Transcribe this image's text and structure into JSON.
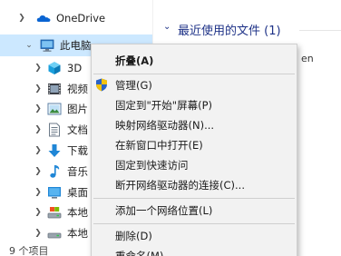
{
  "nav": {
    "onedrive": "OneDrive",
    "this_pc": "此电脑",
    "items": [
      {
        "label": "3D",
        "icon": "3d-objects-icon"
      },
      {
        "label": "视频",
        "icon": "videos-icon"
      },
      {
        "label": "图片",
        "icon": "pictures-icon"
      },
      {
        "label": "文档",
        "icon": "documents-icon"
      },
      {
        "label": "下载",
        "icon": "downloads-icon"
      },
      {
        "label": "音乐",
        "icon": "music-icon"
      },
      {
        "label": "桌面",
        "icon": "desktop-icon"
      },
      {
        "label": "本地",
        "icon": "local-disk-icon"
      },
      {
        "label": "本地",
        "icon": "local-disk-icon"
      }
    ]
  },
  "status": {
    "item_count": "9 个项目"
  },
  "content": {
    "section_title": "最近使用的文件 (1)",
    "truncated_text": "en"
  },
  "context_menu": {
    "items": {
      "collapse": "折叠(A)",
      "manage": "管理(G)",
      "pin_start": "固定到\"开始\"屏幕(P)",
      "map_drive": "映射网络驱动器(N)...",
      "open_new_window": "在新窗口中打开(E)",
      "pin_quick": "固定到快速访问",
      "disconnect_drive": "断开网络驱动器的连接(C)...",
      "add_network_location": "添加一个网络位置(L)",
      "delete": "删除(D)",
      "rename": "重命名(M)"
    }
  },
  "colors": {
    "selection": "#cce8ff",
    "accent": "#1e3287",
    "menu_bg": "#f2f2f2",
    "onedrive": "#0a64d2"
  }
}
